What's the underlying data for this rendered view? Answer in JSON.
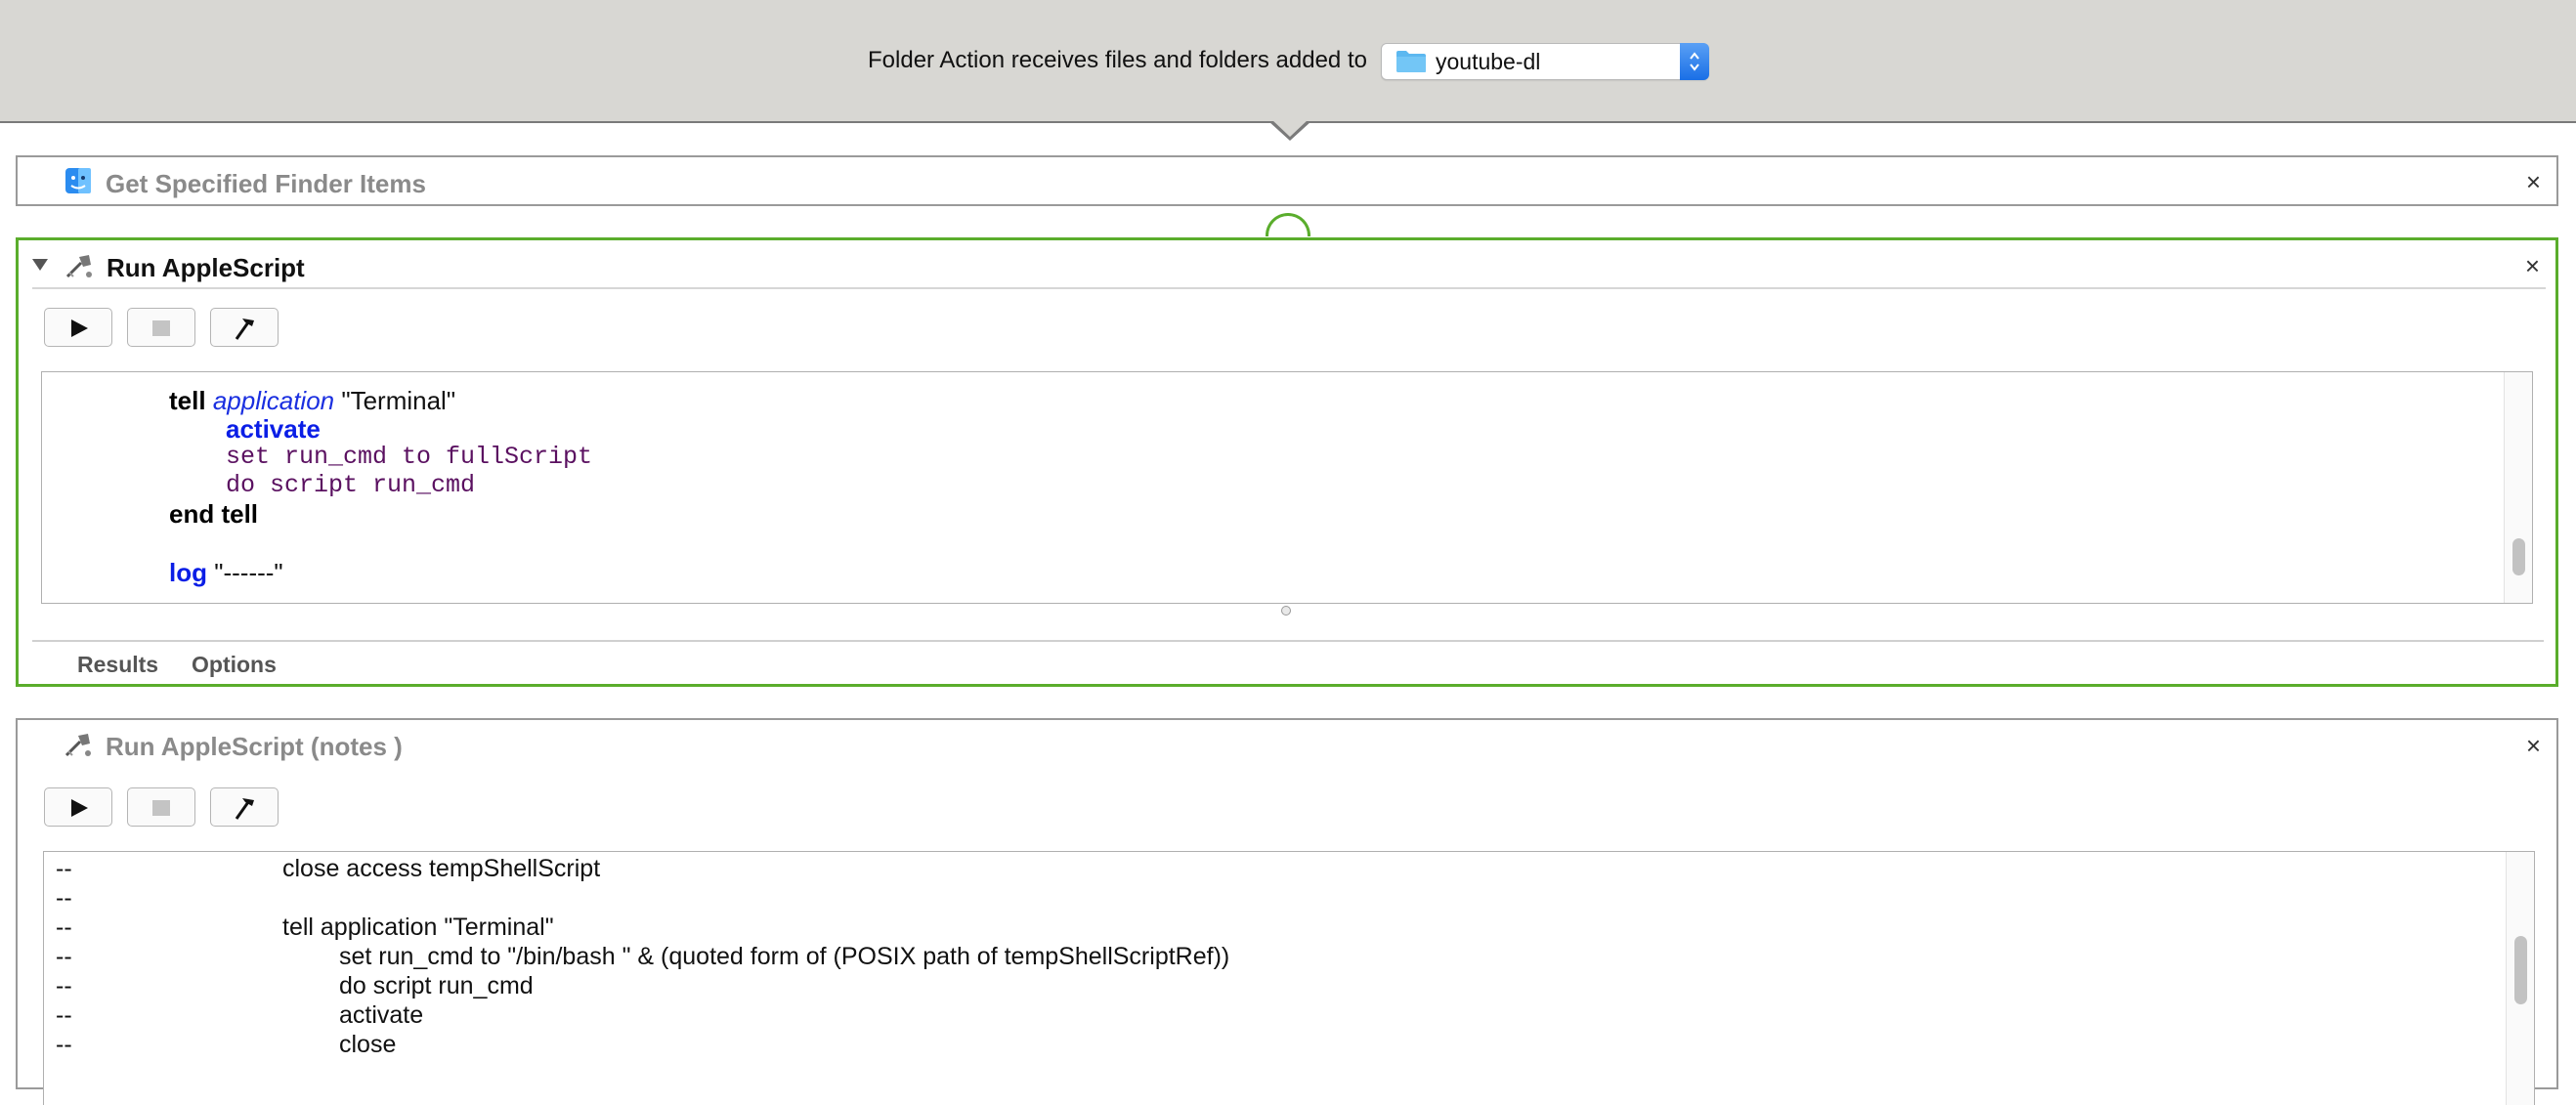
{
  "header": {
    "label": "Folder Action receives files and folders added to",
    "folder_popup": {
      "value": "youtube-dl",
      "icon": "folder-icon"
    }
  },
  "actions": [
    {
      "title": "Get Specified Finder Items",
      "icon": "finder-icon",
      "collapsed": true
    },
    {
      "title": "Run AppleScript",
      "icon": "applescript-icon",
      "selected": true,
      "code": {
        "line1": {
          "kw": "tell",
          "app": "application",
          "target": "\"Terminal\""
        },
        "line2": "activate",
        "line3": "set run_cmd to fullScript",
        "line4": "do script run_cmd",
        "line5": "end tell",
        "line6": {
          "kw": "log",
          "arg": "\"------\""
        }
      },
      "tabs": [
        "Results",
        "Options"
      ]
    },
    {
      "title": "Run AppleScript (notes )",
      "icon": "applescript-icon",
      "code_lines": [
        {
          "prefix": "--",
          "text": "close access tempShellScript"
        },
        {
          "prefix": "--",
          "text": ""
        },
        {
          "prefix": "--",
          "text": "tell application \"Terminal\""
        },
        {
          "prefix": "--",
          "text": "set run_cmd to \"/bin/bash \" & (quoted form of (POSIX path of tempShellScriptRef))"
        },
        {
          "prefix": "--",
          "text": "do script run_cmd"
        },
        {
          "prefix": "--",
          "text": "activate"
        },
        {
          "prefix": "--",
          "text": "close"
        }
      ]
    }
  ],
  "colors": {
    "selected_border": "#5aad2c",
    "keyword_blue": "#0a1ee6",
    "string_purple": "#5a1060",
    "toolbar_bg": "#d8d7d3"
  },
  "close_glyph": "×"
}
